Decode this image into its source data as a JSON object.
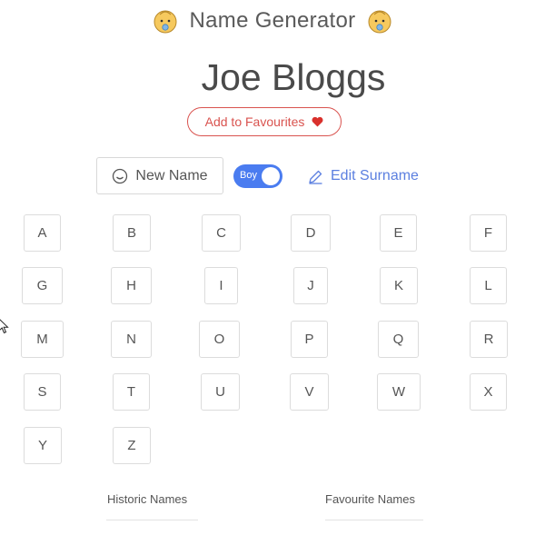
{
  "header": {
    "title": "Name Generator",
    "left_icon": "baby-face-icon",
    "right_icon": "baby-face-icon"
  },
  "current_name": "Joe Bloggs",
  "favourites_button": {
    "label": "Add to Favourites",
    "icon": "heart-icon"
  },
  "controls": {
    "new_name_label": "New Name",
    "new_name_icon": "smile-icon",
    "gender_toggle": {
      "label": "Boy",
      "state": "on"
    },
    "edit_surname_label": "Edit Surname",
    "edit_surname_icon": "pencil-icon"
  },
  "letters": [
    "A",
    "B",
    "C",
    "D",
    "E",
    "F",
    "G",
    "H",
    "I",
    "J",
    "K",
    "L",
    "M",
    "N",
    "O",
    "P",
    "Q",
    "R",
    "S",
    "T",
    "U",
    "V",
    "W",
    "X",
    "Y",
    "Z"
  ],
  "sections": {
    "historic_title": "Historic Names",
    "favourite_title": "Favourite Names"
  },
  "colors": {
    "accent_blue": "#4a7cf0",
    "favourite_red": "#d9534f",
    "link_blue": "#5b7fe0"
  }
}
